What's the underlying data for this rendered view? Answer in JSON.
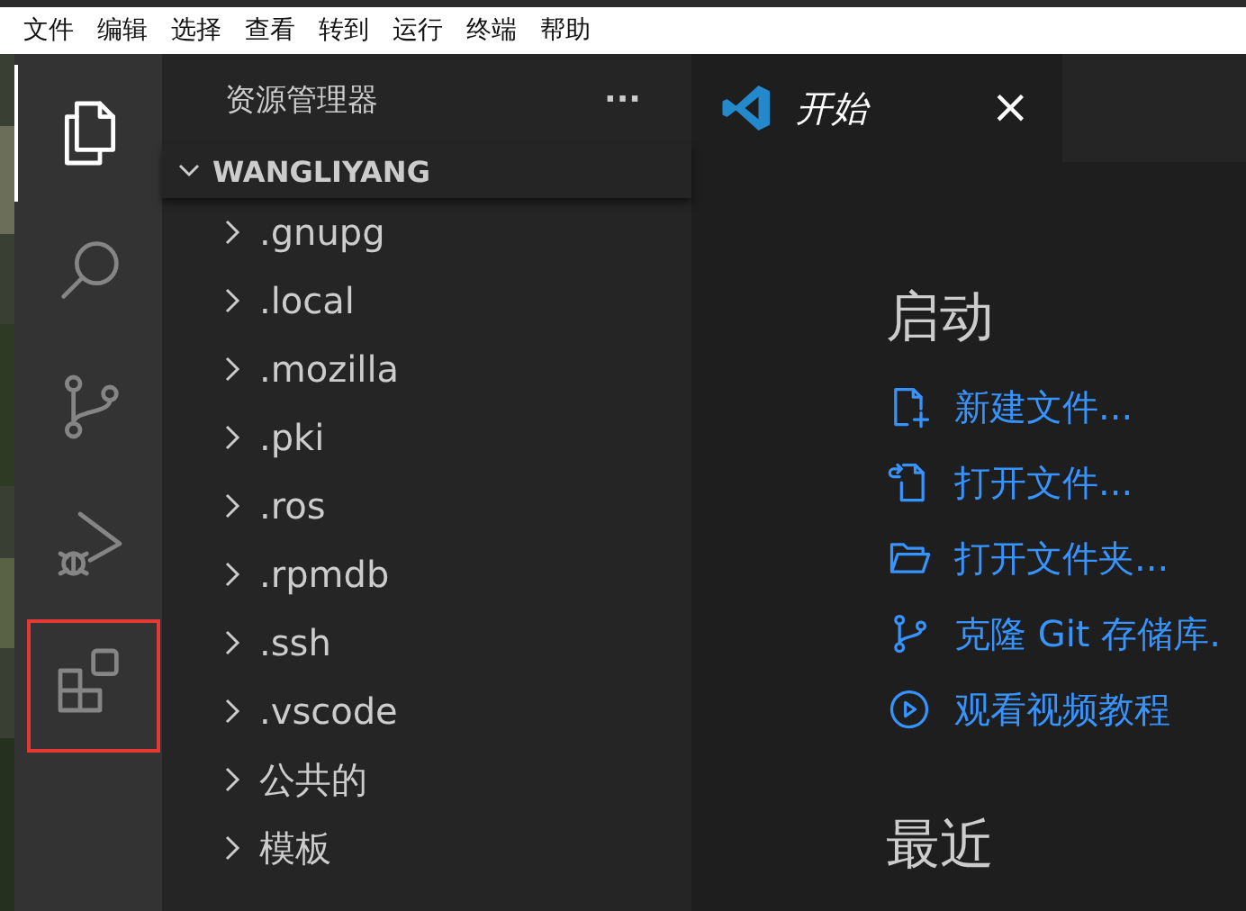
{
  "menu_bar": [
    "文件",
    "编辑",
    "选择",
    "查看",
    "转到",
    "运行",
    "终端",
    "帮助"
  ],
  "activity_bar": [
    {
      "kind": "files",
      "selected": true,
      "highlighted": false
    },
    {
      "kind": "search",
      "selected": false,
      "highlighted": false
    },
    {
      "kind": "source-control",
      "selected": false,
      "highlighted": false
    },
    {
      "kind": "run-debug",
      "selected": false,
      "highlighted": false
    },
    {
      "kind": "extensions",
      "selected": false,
      "highlighted": true
    }
  ],
  "sidebar": {
    "title": "资源管理器",
    "more": "···",
    "folder": {
      "name": "WANGLIYANG",
      "expanded": true
    },
    "items": [
      {
        "name": ".gnupg",
        "expanded": false
      },
      {
        "name": ".local",
        "expanded": false
      },
      {
        "name": ".mozilla",
        "expanded": false
      },
      {
        "name": ".pki",
        "expanded": false
      },
      {
        "name": ".ros",
        "expanded": false
      },
      {
        "name": ".rpmdb",
        "expanded": false
      },
      {
        "name": ".ssh",
        "expanded": false
      },
      {
        "name": ".vscode",
        "expanded": false
      },
      {
        "name": "公共的",
        "expanded": false
      },
      {
        "name": "模板",
        "expanded": false
      }
    ]
  },
  "tabs": [
    {
      "label": "开始",
      "selected": true,
      "close": "×"
    }
  ],
  "welcome": {
    "start_heading": "启动",
    "actions": [
      {
        "kind": "new-file",
        "label": "新建文件..."
      },
      {
        "kind": "open-file",
        "label": "打开文件..."
      },
      {
        "kind": "open-folder",
        "label": "打开文件夹..."
      },
      {
        "kind": "clone",
        "label": "克隆 Git 存储库."
      },
      {
        "kind": "video",
        "label": "观看视频教程"
      }
    ],
    "recent_heading": "最近"
  }
}
